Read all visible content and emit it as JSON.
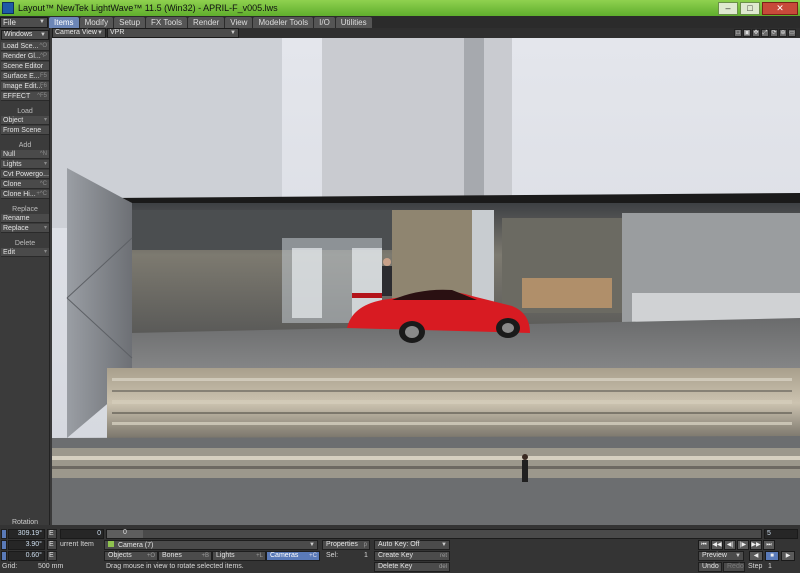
{
  "window": {
    "title": "Layout™ NewTek LightWave™ 11.5 (Win32) - APRIL-F_v005.lws",
    "minimize_glyph": "–",
    "maximize_glyph": "□",
    "close_glyph": "✕"
  },
  "menu": {
    "file_label": "File",
    "tabs": [
      "Items",
      "Modify",
      "Setup",
      "FX Tools",
      "Render",
      "View",
      "Modeler Tools",
      "I/O",
      "Utilities"
    ],
    "active_tab": "Items"
  },
  "left_panel": {
    "windows_label": "Windows",
    "window_buttons": [
      {
        "label": "Load Sce...",
        "shortcut": "^O"
      },
      {
        "label": "Render Gl...",
        "shortcut": "^P"
      },
      {
        "label": "Scene Editor",
        "shortcut": ""
      },
      {
        "label": "Surface E...",
        "shortcut": "F5"
      },
      {
        "label": "Image Edit...",
        "shortcut": "F6"
      },
      {
        "label": "EFFECT",
        "shortcut": "^F5"
      }
    ],
    "load_header": "Load",
    "load_items": [
      {
        "label": "Object",
        "shortcut": "▾"
      },
      {
        "label": "From Scene",
        "shortcut": ""
      }
    ],
    "add_header": "Add",
    "add_items": [
      {
        "label": "Null",
        "shortcut": "^N"
      },
      {
        "label": "Lights",
        "shortcut": "▾"
      },
      {
        "label": "Cvt Powergo...",
        "shortcut": ""
      },
      {
        "label": "Clone",
        "shortcut": "^C"
      },
      {
        "label": "Clone Hi...",
        "shortcut": "+^C"
      }
    ],
    "replace_header": "Replace",
    "replace_items": [
      {
        "label": "Rename",
        "shortcut": ""
      },
      {
        "label": "Replace",
        "shortcut": "▾"
      }
    ],
    "delete_header": "Delete",
    "delete_items": [
      {
        "label": "Edit",
        "shortcut": "▾"
      }
    ],
    "rotation_label": "Rotation"
  },
  "viewport": {
    "view_mode": "Camera View",
    "render_mode": "VPR",
    "corner_icons": [
      "□",
      "▣",
      "✥",
      "⤢",
      "⟳",
      "⊕",
      "▭"
    ]
  },
  "bottom": {
    "rot_values": [
      "309.19°",
      "3.90°",
      "0.60°"
    ],
    "e_label": "E",
    "frame_field": "0",
    "frame_current": "0",
    "current_item_label": "urrent Item",
    "current_item": "Camera (7)",
    "properties_label": "Properties",
    "properties_sc": "p",
    "sel_label": "Sel:",
    "sel_value": "1",
    "autokey_label": "Auto Key: Off",
    "create_key_label": "Create Key",
    "create_key_sc": "ret",
    "delete_key_label": "Delete Key",
    "delete_key_sc": "del",
    "item_tabs": [
      {
        "label": "Objects",
        "sc": "+O"
      },
      {
        "label": "Bones",
        "sc": "+B"
      },
      {
        "label": "Lights",
        "sc": "+L"
      },
      {
        "label": "Cameras",
        "sc": "+C"
      }
    ],
    "active_item_tab": "Cameras",
    "status": "Drag mouse in view to rotate selected items.",
    "grid_label": "Grid:",
    "grid_value": "500 mm",
    "end_frame": "5",
    "preview_label": "Preview",
    "undo_label": "Undo",
    "redo_label": "Redo",
    "step_label": "Step",
    "step_value": "1",
    "transport": [
      "⏮",
      "◀◀",
      "◀|",
      "|▶",
      "▶▶",
      "⏭"
    ],
    "play_buttons": [
      "◀",
      "■",
      "▶"
    ]
  },
  "colors": {
    "title_green": "#6fbd3a",
    "active_tab_blue": "#6c86b7",
    "car_red": "#d81b22"
  }
}
